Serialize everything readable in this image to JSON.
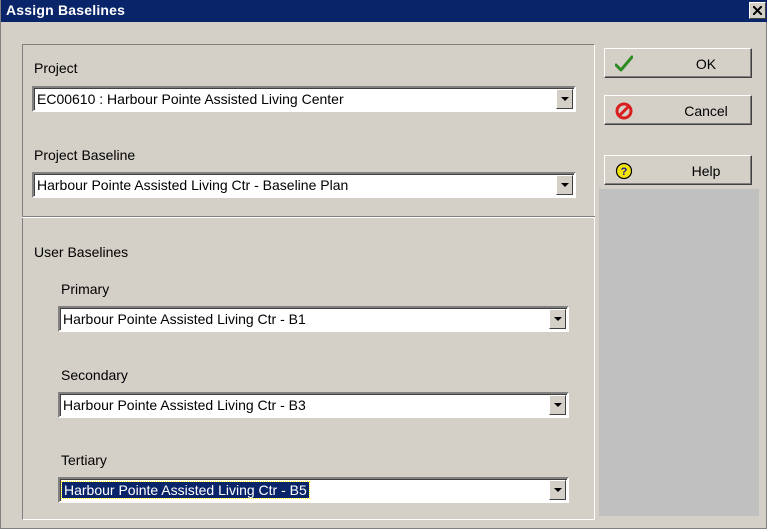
{
  "window": {
    "title": "Assign Baselines"
  },
  "project": {
    "label": "Project",
    "value": "EC00610 : Harbour Pointe Assisted Living Center"
  },
  "project_baseline": {
    "label": "Project Baseline",
    "value": "Harbour Pointe Assisted Living Ctr - Baseline Plan"
  },
  "user_baselines": {
    "label": "User Baselines",
    "primary": {
      "label": "Primary",
      "value": "Harbour Pointe Assisted Living Ctr - B1"
    },
    "secondary": {
      "label": "Secondary",
      "value": "Harbour Pointe Assisted Living Ctr - B3"
    },
    "tertiary": {
      "label": "Tertiary",
      "value": "Harbour Pointe Assisted Living Ctr - B5"
    }
  },
  "buttons": {
    "ok": {
      "label": "OK",
      "icon": "check-icon"
    },
    "cancel": {
      "label": "Cancel",
      "icon": "cancel-icon"
    },
    "help": {
      "label": "Help",
      "icon": "help-icon"
    }
  },
  "colors": {
    "titlebar": "#0a246a",
    "dialog": "#d4d0c8",
    "ok_check": "#2e8b22",
    "cancel_red": "#d81e1e",
    "help_yellow": "#f5e40a"
  }
}
